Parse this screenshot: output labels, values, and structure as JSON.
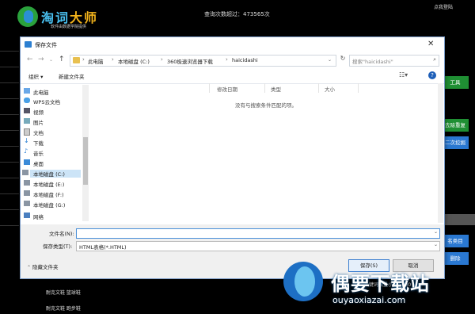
{
  "app": {
    "logo_title_1": "淘",
    "logo_title_2": "词",
    "logo_title_3": "大师",
    "logo_subtitle": "软件由数据学院提供",
    "query_count": "查询次数超过：473565次",
    "login_label": "点我登陆",
    "right_buttons": [
      "工具",
      "去除重复",
      "二次挖掘",
      "名类目",
      "删除"
    ],
    "bottom_row1": "耐克文鞋  篮球鞋",
    "bottom_row2": "耐克文鞋  跑步鞋",
    "bottom_status": "关键词数量小于 5000"
  },
  "watermark": {
    "text": "偶要下载站",
    "url": "ouyaoxiazai.com"
  },
  "dialog": {
    "title": "保存文件",
    "breadcrumbs": [
      "此电脑",
      "本地磁盘 (C:)",
      "360极速浏览器下载",
      "haicidashi"
    ],
    "search_placeholder": "搜索\"haicidashi\"",
    "toolbar": {
      "organize": "组织 ▾",
      "new_folder": "新建文件夹"
    },
    "sidebar_items": [
      {
        "label": "此电脑",
        "icon": "computer-icon",
        "selected": false
      },
      {
        "label": "WPS云文档",
        "icon": "cloud-icon",
        "selected": false
      },
      {
        "label": "视频",
        "icon": "video-icon",
        "selected": false
      },
      {
        "label": "图片",
        "icon": "picture-icon",
        "selected": false
      },
      {
        "label": "文档",
        "icon": "document-icon",
        "selected": false
      },
      {
        "label": "下载",
        "icon": "download-icon",
        "selected": false
      },
      {
        "label": "音乐",
        "icon": "music-icon",
        "selected": false
      },
      {
        "label": "桌面",
        "icon": "desktop-icon",
        "selected": false
      },
      {
        "label": "本地磁盘 (C:)",
        "icon": "drive-icon",
        "selected": true
      },
      {
        "label": "本地磁盘 (E:)",
        "icon": "drive-icon",
        "selected": false
      },
      {
        "label": "本地磁盘 (F:)",
        "icon": "drive-icon",
        "selected": false
      },
      {
        "label": "本地磁盘 (G:)",
        "icon": "drive-icon",
        "selected": false
      },
      {
        "label": "网络",
        "icon": "network-icon",
        "selected": false
      }
    ],
    "columns": [
      "修改日期",
      "类型",
      "大小"
    ],
    "empty_message": "没有与搜索条件匹配的项。",
    "file_name_label": "文件名(N):",
    "file_name_value": "",
    "file_type_label": "保存类型(T):",
    "file_type_value": "HTML表格(*.HTML)",
    "hide_folders": "隐藏文件夹",
    "save_label": "保存(S)",
    "cancel_label": "取消"
  },
  "colors": {
    "selection": "#cce4f7",
    "accent": "#1e5fb8",
    "green_button": "#1f8f33",
    "blue_button": "#2a78d1"
  }
}
